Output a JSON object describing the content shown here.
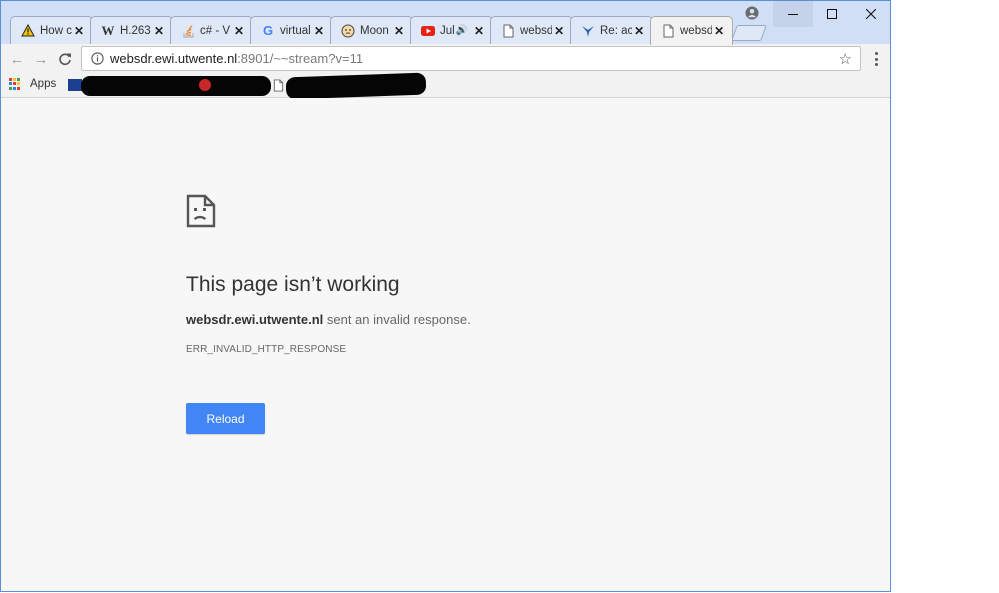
{
  "tabs": [
    {
      "title": "How c",
      "icon": "warning-icon",
      "active": false
    },
    {
      "title": "H.263",
      "icon": "wikipedia-icon",
      "active": false
    },
    {
      "title": "c# - V",
      "icon": "stackoverflow-icon",
      "active": false
    },
    {
      "title": "virtual",
      "icon": "google-icon",
      "active": false
    },
    {
      "title": "Moon",
      "icon": "moon-face-icon",
      "active": false
    },
    {
      "title": "Jul",
      "icon": "youtube-icon",
      "active": false,
      "audio": true
    },
    {
      "title": "websd",
      "icon": "page-icon",
      "active": false
    },
    {
      "title": "Re: ac",
      "icon": "bird-icon",
      "active": false
    },
    {
      "title": "websd",
      "icon": "page-icon",
      "active": true
    }
  ],
  "address": {
    "domain": "websdr.ewi.utwente.nl",
    "rest": ":8901/~~stream?v=11"
  },
  "bookmarks": {
    "apps_label": "Apps"
  },
  "error": {
    "title": "This page isn’t working",
    "host": "websdr.ewi.utwente.nl",
    "message": " sent an invalid response.",
    "code": "ERR_INVALID_HTTP_RESPONSE",
    "reload_label": "Reload"
  },
  "colors": {
    "reload_button": "#4285f4",
    "window_border": "#5b8fd6",
    "tabstrip": "#d0dff5"
  }
}
